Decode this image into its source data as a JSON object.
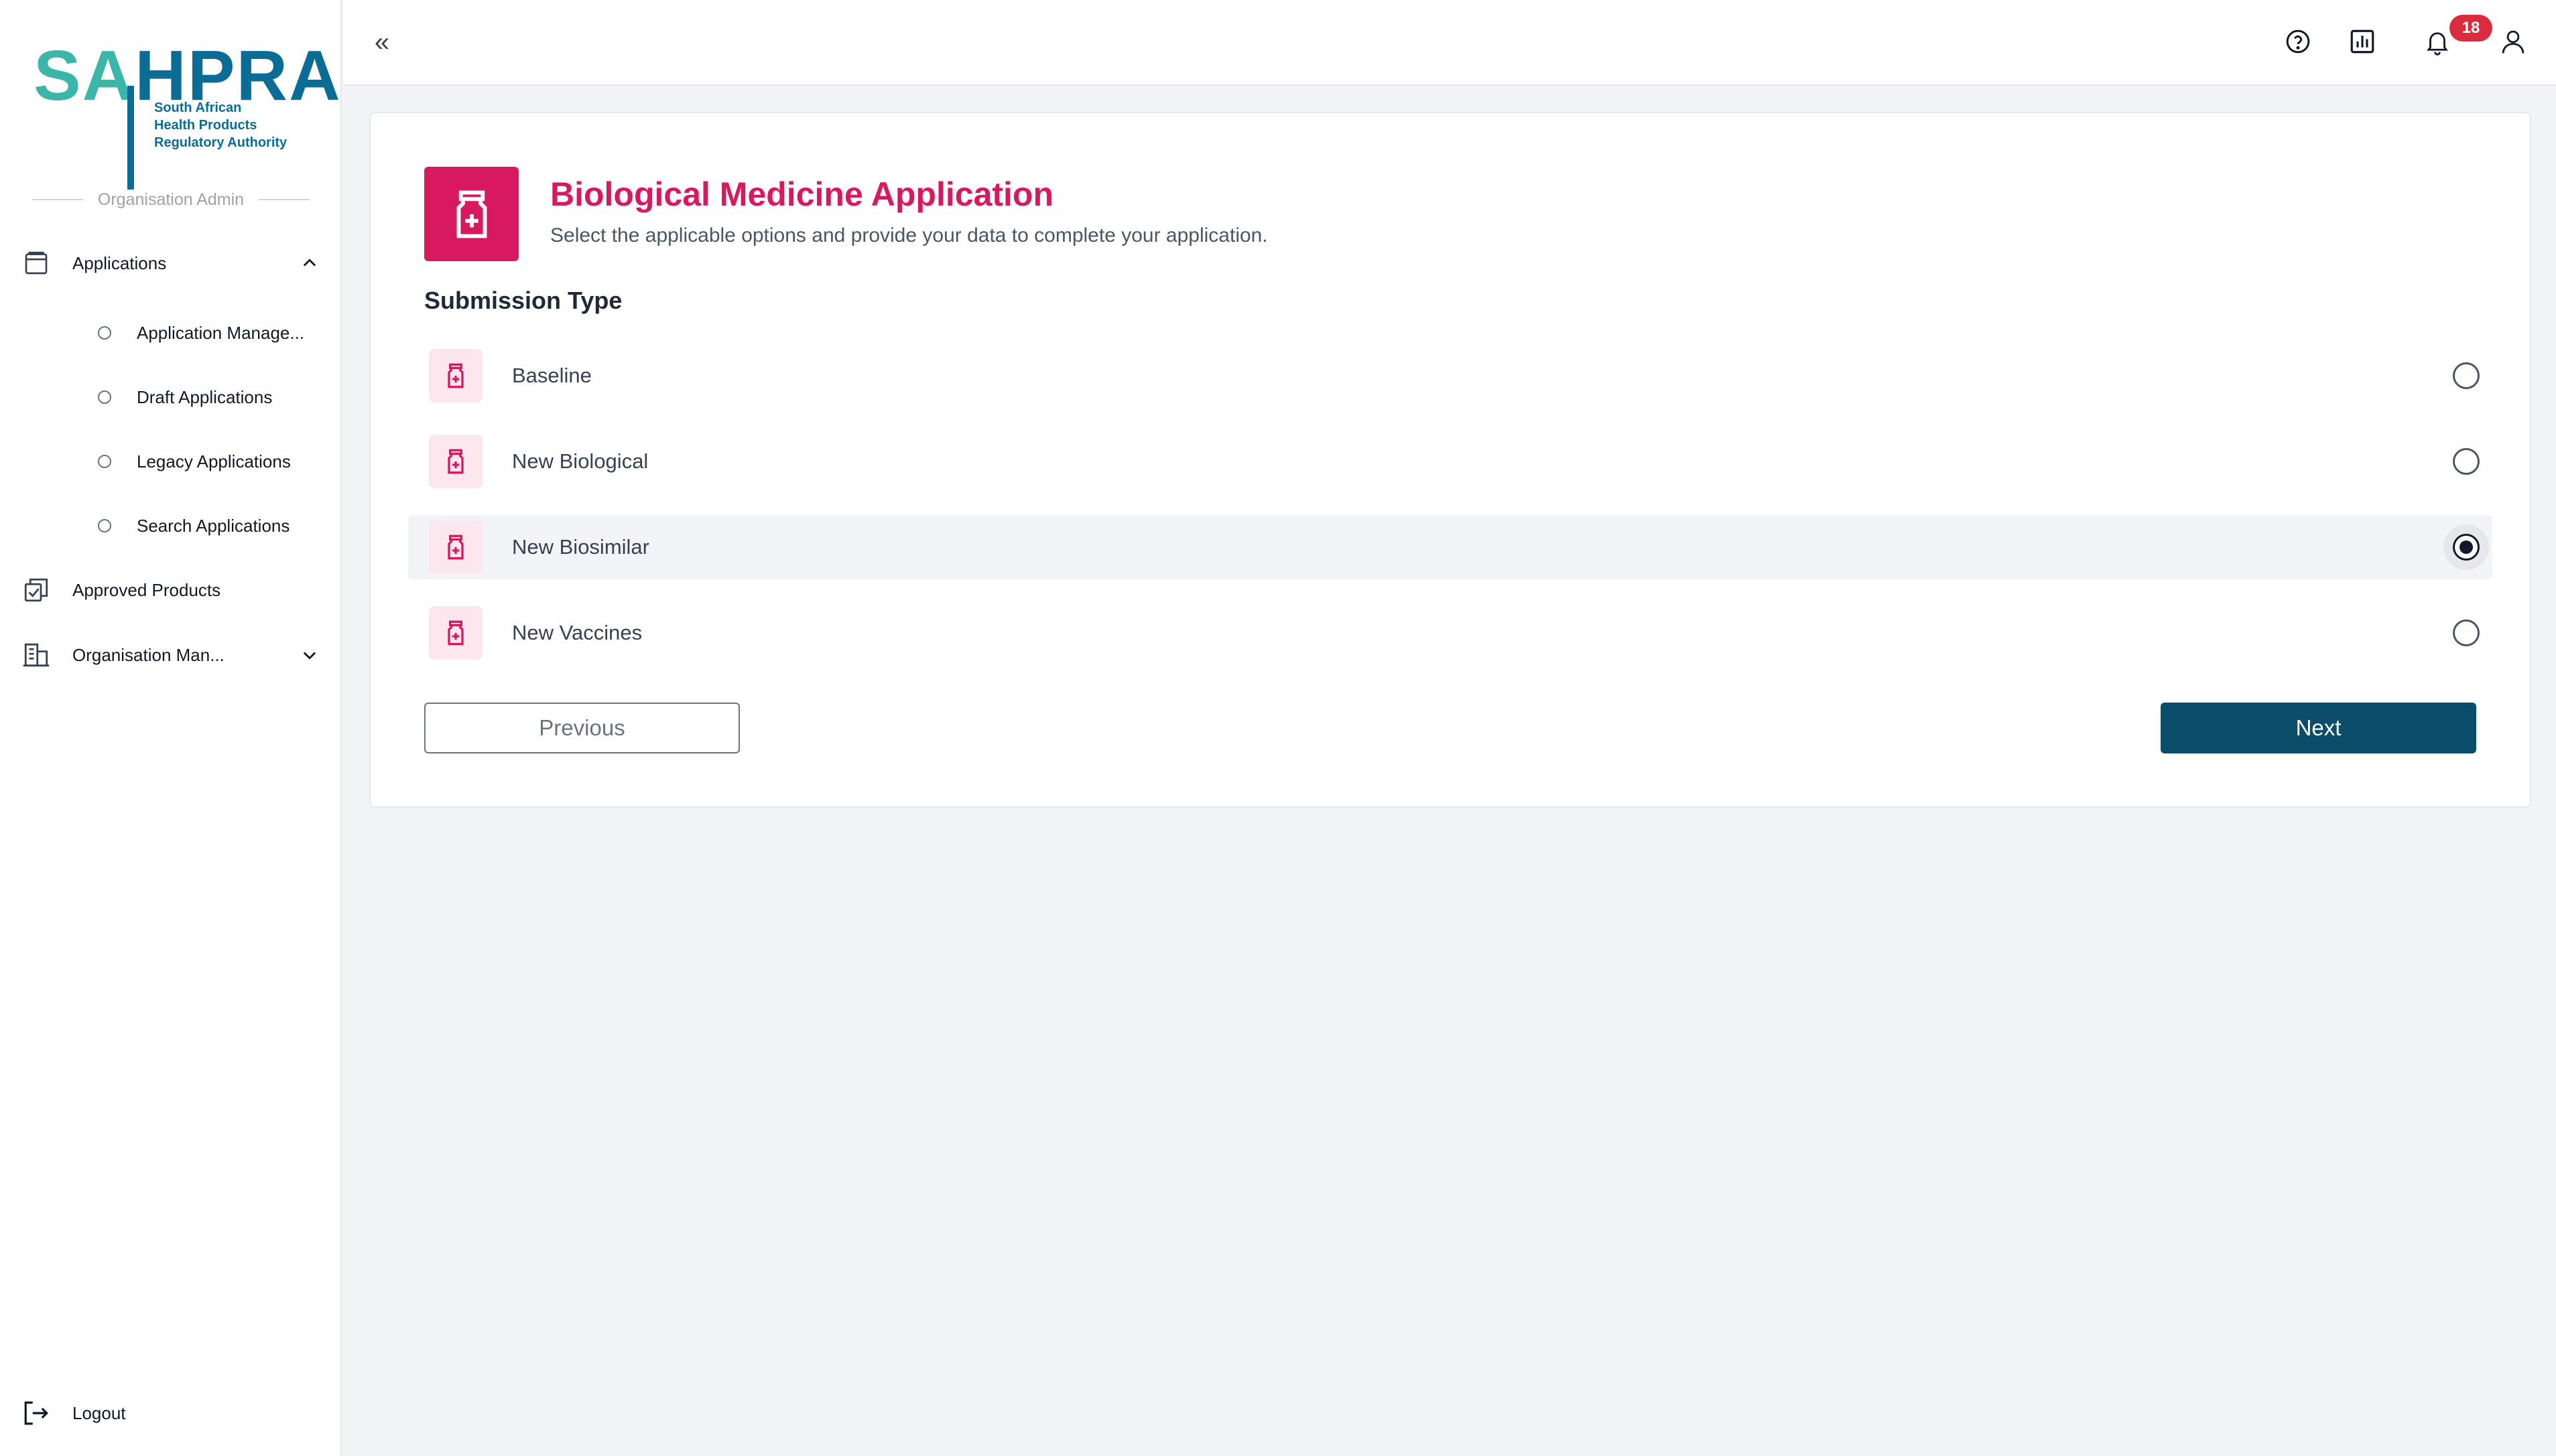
{
  "brand": {
    "logo_sa": "SA",
    "logo_hpra": "HPRA",
    "logo_sub_1": "South African",
    "logo_sub_2": "Health Products",
    "logo_sub_3": "Regulatory Authority",
    "primary_color": "#0b6c95",
    "secondary_color": "#3bb6a9",
    "accent_color": "#d9195f"
  },
  "sidebar": {
    "role_label": "Organisation Admin",
    "applications_label": "Applications",
    "sub_items": [
      {
        "label": "Application Manage..."
      },
      {
        "label": "Draft Applications"
      },
      {
        "label": "Legacy Applications"
      },
      {
        "label": "Search Applications"
      }
    ],
    "approved_products_label": "Approved Products",
    "organisation_label": "Organisation Man...",
    "logout_label": "Logout"
  },
  "topbar": {
    "collapse_glyph": "«",
    "notification_count": "18",
    "icons": [
      "help-icon",
      "report-icon",
      "bell-icon",
      "user-icon"
    ]
  },
  "form": {
    "title": "Biological Medicine Application",
    "subtitle": "Select the applicable options and provide your data to complete your application.",
    "section_title": "Submission Type",
    "options": [
      {
        "label": "Baseline",
        "selected": false
      },
      {
        "label": "New Biological",
        "selected": false
      },
      {
        "label": "New Biosimilar",
        "selected": true
      },
      {
        "label": "New Vaccines",
        "selected": false
      }
    ],
    "previous_label": "Previous",
    "next_label": "Next"
  }
}
